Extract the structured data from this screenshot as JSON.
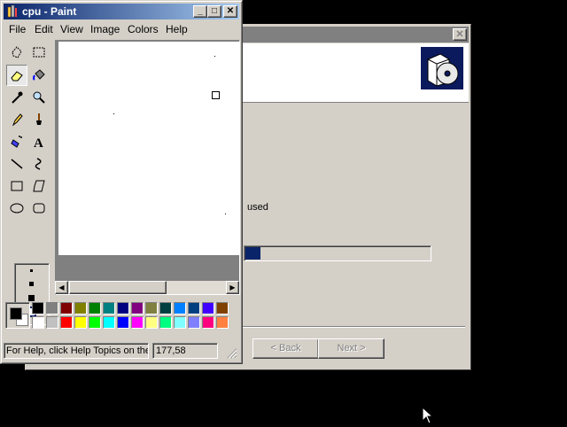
{
  "paint": {
    "title": "cpu - Paint",
    "menu": [
      "File",
      "Edit",
      "View",
      "Image",
      "Colors",
      "Help"
    ],
    "status_help": "For Help, click Help Topics on the Help Menu.",
    "status_coords": "177,58",
    "tools": [
      "free-form-select-icon",
      "rect-select-icon",
      "eraser-icon",
      "fill-icon",
      "color-picker-icon",
      "magnifier-icon",
      "pencil-icon",
      "brush-icon",
      "airbrush-icon",
      "text-icon",
      "line-icon",
      "curve-icon",
      "rectangle-icon",
      "polygon-icon",
      "ellipse-icon",
      "rounded-rect-icon"
    ],
    "selected_tool": "eraser-icon",
    "foreground_color": "#000000",
    "background_color": "#ffffff",
    "palette_top": [
      "#000000",
      "#808080",
      "#800000",
      "#808000",
      "#008000",
      "#008080",
      "#000080",
      "#800080",
      "#808040",
      "#004040",
      "#0080ff",
      "#004080",
      "#4000ff",
      "#804000"
    ],
    "palette_bottom": [
      "#ffffff",
      "#c0c0c0",
      "#ff0000",
      "#ffff00",
      "#00ff00",
      "#00ffff",
      "#0000ff",
      "#ff00ff",
      "#ffff80",
      "#00ff80",
      "#80ffff",
      "#8080ff",
      "#ff0080",
      "#ff8040"
    ]
  },
  "wizard": {
    "used_text": "used",
    "back_label": "< Back",
    "next_label": "Next >",
    "progress_fraction": 0.08
  }
}
